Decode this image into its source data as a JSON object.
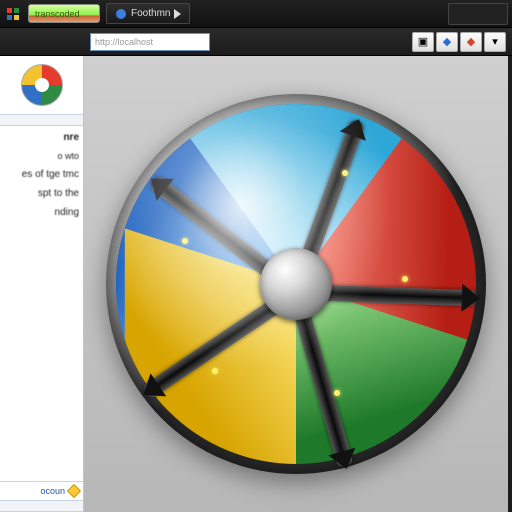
{
  "titlebar": {
    "seg1_label": "transcoded",
    "tab_label": "Foothmn",
    "address_placeholder": "http://localhost"
  },
  "toolbar": {
    "btn_play": "▣",
    "btn_gem1": "◆",
    "btn_gem2": "◆",
    "btn_drop": "▾"
  },
  "sidebar": {
    "heading": "nre",
    "sub": "o wto",
    "items": [
      "es of tge tmc",
      "spt to the",
      "nding"
    ],
    "bottom_label": "ocoun"
  },
  "colors": {
    "accent_blue": "#1a5fbf",
    "accent_red": "#b51e14",
    "accent_green": "#1e7a2a",
    "accent_yellow": "#d7a400"
  }
}
